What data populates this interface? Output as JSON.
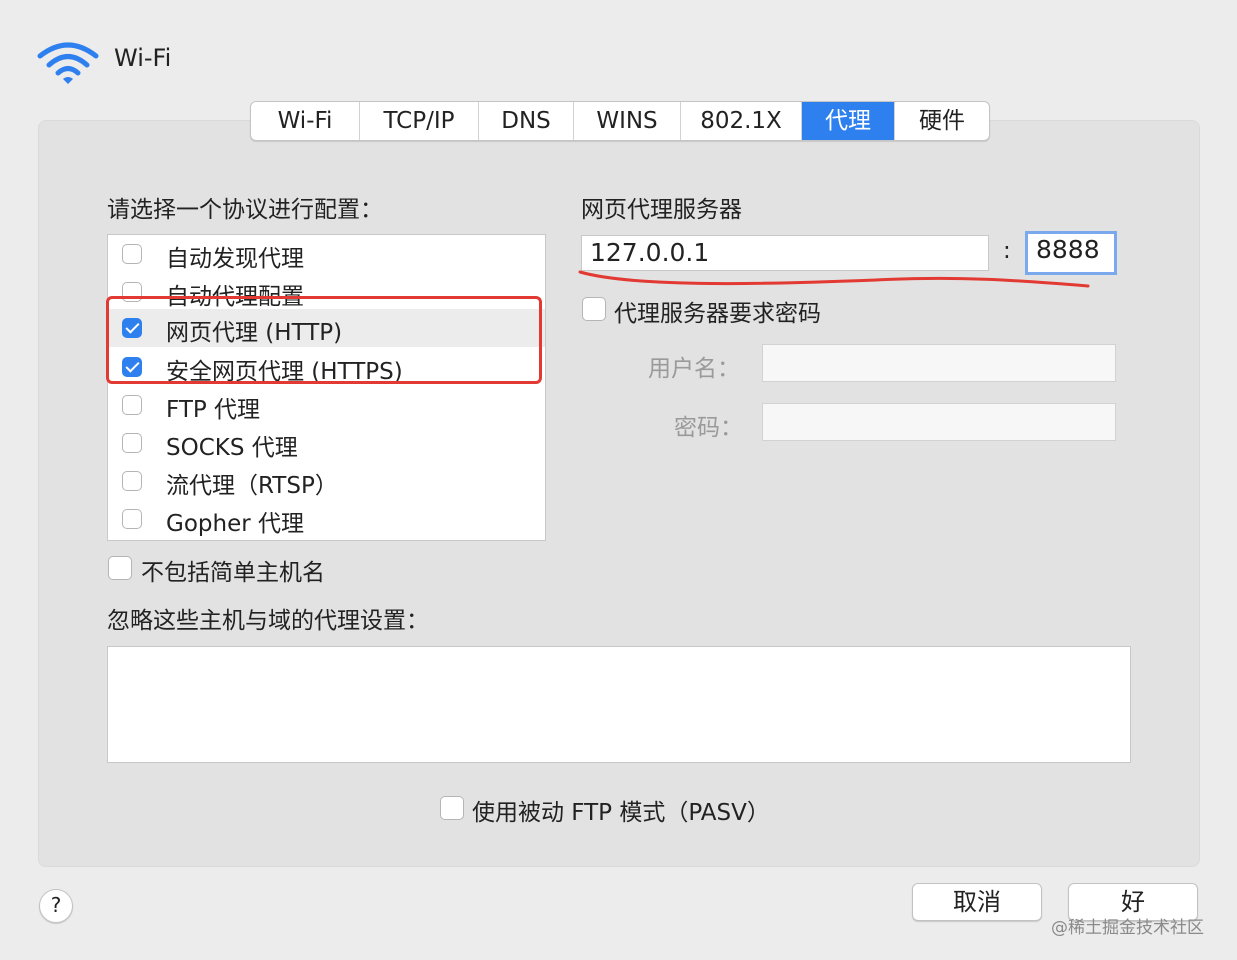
{
  "window": {
    "title": "Wi-Fi"
  },
  "tabs": [
    {
      "label": "Wi-Fi",
      "selected": false
    },
    {
      "label": "TCP/IP",
      "selected": false
    },
    {
      "label": "DNS",
      "selected": false
    },
    {
      "label": "WINS",
      "selected": false
    },
    {
      "label": "802.1X",
      "selected": false
    },
    {
      "label": "代理",
      "selected": true
    },
    {
      "label": "硬件",
      "selected": false
    }
  ],
  "protocol_section": {
    "label": "请选择一个协议进行配置：",
    "items": [
      {
        "label": "自动发现代理",
        "checked": false
      },
      {
        "label": "自动代理配置",
        "checked": false
      },
      {
        "label": "网页代理 (HTTP)",
        "checked": true
      },
      {
        "label": "安全网页代理 (HTTPS)",
        "checked": true
      },
      {
        "label": "FTP 代理",
        "checked": false
      },
      {
        "label": "SOCKS 代理",
        "checked": false
      },
      {
        "label": "流代理（RTSP）",
        "checked": false
      },
      {
        "label": "Gopher 代理",
        "checked": false
      }
    ]
  },
  "server_section": {
    "label": "网页代理服务器",
    "host_value": "127.0.0.1",
    "port_separator": ":",
    "port_value": "8888",
    "requires_password_label": "代理服务器要求密码",
    "requires_password_checked": false,
    "username_label": "用户名：",
    "username_value": "",
    "password_label": "密码：",
    "password_value": ""
  },
  "exclude_simple_hostnames": {
    "label": "不包括简单主机名",
    "checked": false
  },
  "bypass": {
    "label": "忽略这些主机与域的代理设置：",
    "value": ""
  },
  "passive_ftp": {
    "label": "使用被动 FTP 模式（PASV）",
    "checked": false
  },
  "buttons": {
    "help": "?",
    "cancel": "取消",
    "ok": "好"
  },
  "watermark": "@稀土掘金技术社区",
  "colors": {
    "accent": "#2f80ef",
    "annotation": "#e23a32"
  }
}
